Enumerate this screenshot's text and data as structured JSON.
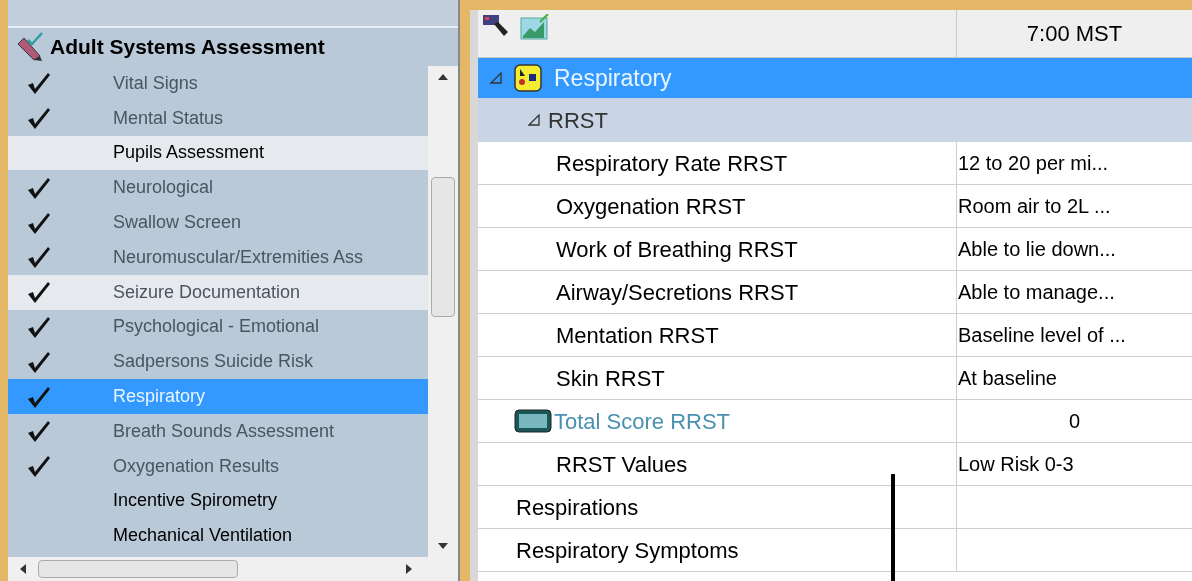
{
  "sidebar": {
    "title": "Adult Systems Assessment",
    "items": [
      {
        "label": "Vital Signs",
        "checked": true,
        "selected": false,
        "highlighted": false
      },
      {
        "label": "Mental Status",
        "checked": true,
        "selected": false,
        "highlighted": false
      },
      {
        "label": "Pupils Assessment",
        "checked": false,
        "selected": false,
        "highlighted": true
      },
      {
        "label": "Neurological",
        "checked": true,
        "selected": false,
        "highlighted": false
      },
      {
        "label": "Swallow Screen",
        "checked": true,
        "selected": false,
        "highlighted": false
      },
      {
        "label": "Neuromuscular/Extremities Ass",
        "checked": true,
        "selected": false,
        "highlighted": false
      },
      {
        "label": "Seizure Documentation",
        "checked": true,
        "selected": false,
        "highlighted": true
      },
      {
        "label": "Psychological - Emotional",
        "checked": true,
        "selected": false,
        "highlighted": false
      },
      {
        "label": "Sadpersons Suicide Risk",
        "checked": true,
        "selected": false,
        "highlighted": false
      },
      {
        "label": "Respiratory",
        "checked": true,
        "selected": true
      },
      {
        "label": "Breath Sounds Assessment",
        "checked": true,
        "selected": false,
        "highlighted": false
      },
      {
        "label": "Oxygenation Results",
        "checked": true,
        "selected": false,
        "highlighted": false
      },
      {
        "label": "Incentive Spirometry",
        "checked": false,
        "selected": false,
        "highlighted": false
      },
      {
        "label": "Mechanical Ventilation",
        "checked": false,
        "selected": false,
        "highlighted": false
      }
    ]
  },
  "grid": {
    "column_header": "7:00 MST",
    "rows": [
      {
        "kind": "section",
        "label": "Respiratory",
        "expanded": true,
        "selected": true
      },
      {
        "kind": "group",
        "label": "RRST",
        "expanded": true
      },
      {
        "kind": "item",
        "label": "Respiratory Rate RRST",
        "value": "12 to 20 per mi..."
      },
      {
        "kind": "item",
        "label": "Oxygenation RRST",
        "value": "Room air to 2L ..."
      },
      {
        "kind": "item",
        "label": "Work of Breathing RRST",
        "value": "Able to lie down..."
      },
      {
        "kind": "item",
        "label": "Airway/Secretions RRST",
        "value": "Able to manage..."
      },
      {
        "kind": "item",
        "label": "Mentation RRST",
        "value": "Baseline level of ..."
      },
      {
        "kind": "item",
        "label": "Skin RRST",
        "value": "At baseline"
      },
      {
        "kind": "calc",
        "label": "Total Score RRST",
        "value": "0"
      },
      {
        "kind": "item",
        "label": "RRST Values",
        "value": "Low Risk 0-3"
      },
      {
        "kind": "top",
        "label": "Respirations"
      },
      {
        "kind": "top",
        "label": "Respiratory Symptoms"
      }
    ]
  }
}
